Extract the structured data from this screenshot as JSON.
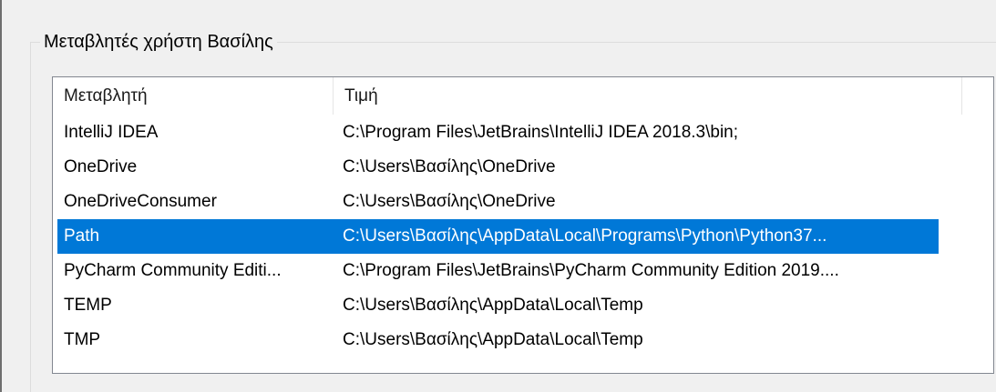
{
  "group": {
    "title": "Μεταβλητές χρήστη Βασίλης"
  },
  "table": {
    "headers": {
      "name": "Μεταβλητή",
      "value": "Τιμή"
    },
    "rows": [
      {
        "name": "IntelliJ IDEA",
        "value": "C:\\Program Files\\JetBrains\\IntelliJ IDEA 2018.3\\bin;",
        "selected": false
      },
      {
        "name": "OneDrive",
        "value": "C:\\Users\\Βασίλης\\OneDrive",
        "selected": false
      },
      {
        "name": "OneDriveConsumer",
        "value": "C:\\Users\\Βασίλης\\OneDrive",
        "selected": false
      },
      {
        "name": "Path",
        "value": "C:\\Users\\Βασίλης\\AppData\\Local\\Programs\\Python\\Python37...",
        "selected": true
      },
      {
        "name": "PyCharm Community Editi...",
        "value": "C:\\Program Files\\JetBrains\\PyCharm Community Edition 2019....",
        "selected": false
      },
      {
        "name": "TEMP",
        "value": "C:\\Users\\Βασίλης\\AppData\\Local\\Temp",
        "selected": false
      },
      {
        "name": "TMP",
        "value": "C:\\Users\\Βασίλης\\AppData\\Local\\Temp",
        "selected": false
      }
    ]
  },
  "colors": {
    "selection": "#0078d7",
    "window_bg": "#f0f0f0",
    "list_border": "#828790"
  }
}
